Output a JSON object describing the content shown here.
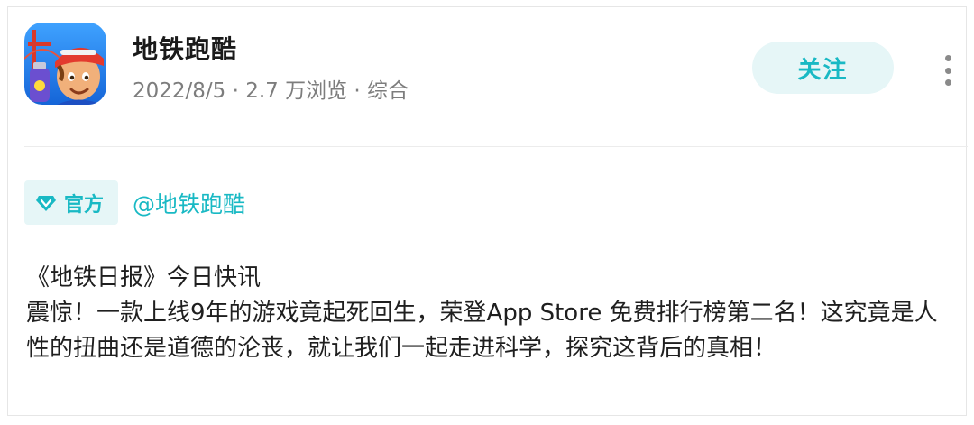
{
  "post": {
    "author": "地铁跑酷",
    "meta": "2022/8/5 · 2.7 万浏览 · 综合",
    "follow_label": "关注",
    "badge_label": "官方",
    "mention": "@地铁跑酷",
    "headline": "《地铁日报》今日快讯",
    "body": "震惊！一款上线9年的游戏竟起死回生，荣登App Store 免费排行榜第二名！这究竟是人性的扭曲还是道德的沦丧，就让我们一起走进科学，探究这背后的真相！"
  },
  "icons": {
    "app": "subway-surfers-app-icon",
    "more": "more-vertical-icon",
    "badge": "diamond-icon"
  },
  "colors": {
    "accent": "#19b9c4",
    "accent_bg": "#e6f6f7",
    "meta_text": "#7d7d7d"
  }
}
